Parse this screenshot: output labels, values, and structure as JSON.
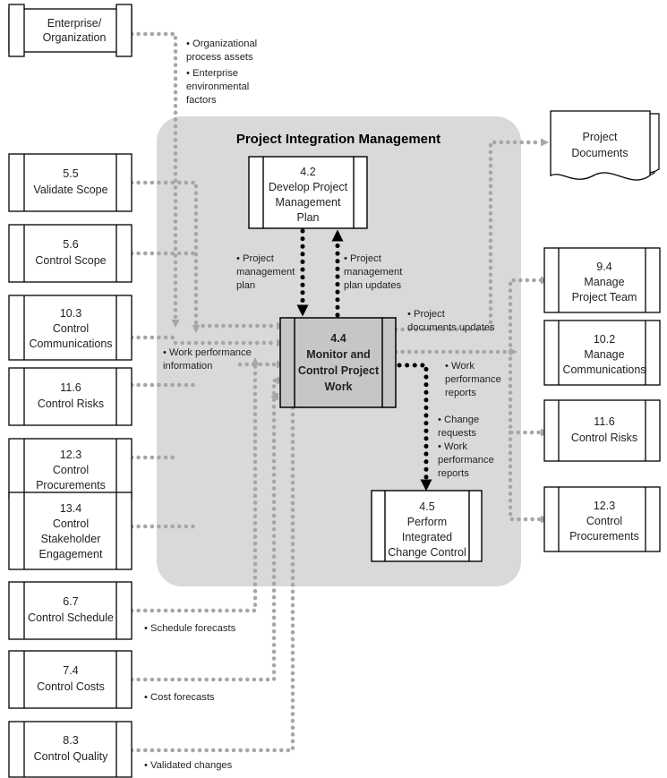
{
  "diagram": {
    "panel_title": "Project Integration Management",
    "colors": {
      "panel_fill": "#d9d9d9",
      "process_fill": "#c6c6c6",
      "box_fill": "#ffffff",
      "stroke": "#000000",
      "flow_gray": "#a6a6a6",
      "flow_black": "#000000",
      "text": "#231f20"
    }
  },
  "external_top": {
    "id": "enterprise-organization",
    "lines": [
      "Enterprise/",
      "Organization"
    ]
  },
  "inputs_left": [
    {
      "id": "validate-scope",
      "number": "5.5",
      "lines": [
        "Validate Scope"
      ]
    },
    {
      "id": "control-scope",
      "number": "5.6",
      "lines": [
        "Control Scope"
      ]
    },
    {
      "id": "control-communications",
      "number": "10.3",
      "lines": [
        "Control",
        "Communications"
      ]
    },
    {
      "id": "control-risks",
      "number": "11.6",
      "lines": [
        "Control Risks"
      ]
    },
    {
      "id": "control-procurements",
      "number": "12.3",
      "lines": [
        "Control",
        "Procurements"
      ]
    },
    {
      "id": "control-stakeholder",
      "number": "13.4",
      "lines": [
        "Control",
        "Stakeholder",
        "Engagement"
      ]
    },
    {
      "id": "control-schedule",
      "number": "6.7",
      "lines": [
        "Control Schedule"
      ]
    },
    {
      "id": "control-costs",
      "number": "7.4",
      "lines": [
        "Control Costs"
      ]
    },
    {
      "id": "control-quality",
      "number": "8.3",
      "lines": [
        "Control Quality"
      ]
    }
  ],
  "outputs_right": [
    {
      "id": "manage-project-team",
      "number": "9.4",
      "lines": [
        "Manage",
        "Project Team"
      ]
    },
    {
      "id": "manage-communications",
      "number": "10.2",
      "lines": [
        "Manage",
        "Communications"
      ]
    },
    {
      "id": "control-risks-out",
      "number": "11.6",
      "lines": [
        "Control Risks"
      ]
    },
    {
      "id": "control-procurements-out",
      "number": "12.3",
      "lines": [
        "Control",
        "Procurements"
      ]
    }
  ],
  "document_store": {
    "id": "project-documents",
    "lines": [
      "Project",
      "Documents"
    ]
  },
  "processes": {
    "develop_plan": {
      "number": "4.2",
      "lines": [
        "Develop Project",
        "Management",
        "Plan"
      ]
    },
    "monitor_control": {
      "number": "4.4",
      "lines": [
        "Monitor and",
        "Control Project",
        "Work"
      ]
    },
    "change_control": {
      "number": "4.5",
      "lines": [
        "Perform",
        "Integrated",
        "Change Control"
      ]
    }
  },
  "annotations": {
    "enterprise_flow": [
      "• Organizational",
      "   process assets",
      "• Enterprise",
      "   environmental",
      "   factors"
    ],
    "pm_plan": [
      "• Project",
      "   management",
      "   plan"
    ],
    "pm_plan_updates": [
      "• Project",
      "   management",
      "   plan updates"
    ],
    "work_perf_information": [
      "• Work performance",
      "   information"
    ],
    "project_docs_updates": [
      "• Project",
      "   documents updates"
    ],
    "work_perf_reports": [
      "• Work",
      "   performance",
      "   reports"
    ],
    "change_requests": [
      "• Change",
      "   requests",
      "• Work",
      "   performance",
      "   reports"
    ],
    "schedule_forecasts": [
      "• Schedule forecasts"
    ],
    "cost_forecasts": [
      "• Cost forecasts"
    ],
    "validated_changes": [
      "• Validated changes"
    ]
  }
}
